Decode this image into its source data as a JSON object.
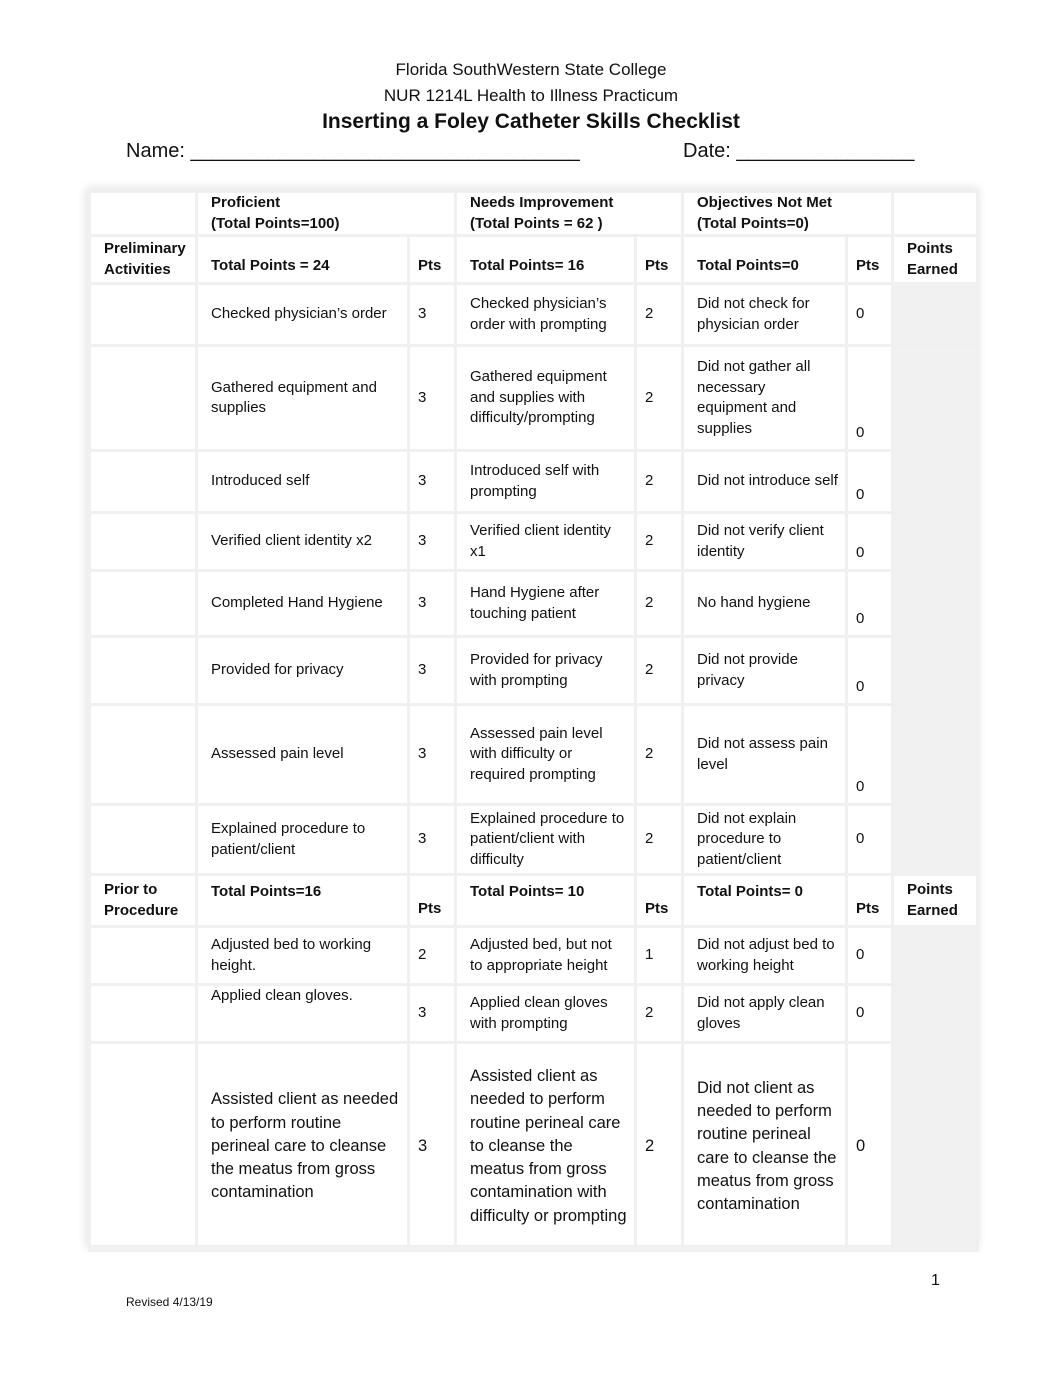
{
  "header": {
    "institution": "Florida SouthWestern State College",
    "course": "NUR 1214L Health to Illness Practicum",
    "title": "Inserting a Foley Catheter Skills Checklist",
    "name_label": "Name: ___________________________________",
    "date_label": "Date: ________________"
  },
  "table": {
    "levels": {
      "proficient": {
        "title": "Proficient",
        "total": "(Total Points=100)"
      },
      "needs_improvement": {
        "title": "Needs Improvement",
        "total": "(Total Points = 62 )"
      },
      "not_met": {
        "title": "Objectives Not Met",
        "total": "(Total Points=0)"
      }
    },
    "sections": [
      {
        "name": "Preliminary Activities",
        "proficient_total": "Total Points = 24",
        "needs_total": "Total Points= 16",
        "notmet_total": "Total Points=0",
        "pts_label": "Pts",
        "earned_label": "Points Earned",
        "rows": [
          {
            "proficient": "Checked physician’s order",
            "p_pts": "3",
            "needs": "Checked physician’s order with prompting",
            "n_pts": "2",
            "notmet": "Did not check for physician order",
            "m_pts": "0"
          },
          {
            "proficient": "Gathered equipment and supplies",
            "p_pts": "3",
            "needs": "Gathered equipment and supplies with difficulty/prompting",
            "n_pts": "2",
            "notmet": "Did not gather all necessary equipment and supplies",
            "m_pts": "0"
          },
          {
            "proficient": "Introduced self",
            "p_pts": "3",
            "needs": "Introduced self with prompting",
            "n_pts": "2",
            "notmet": "Did not introduce self",
            "m_pts": "0"
          },
          {
            "proficient": "Verified client identity x2",
            "p_pts": "3",
            "needs": "Verified client identity x1",
            "n_pts": "2",
            "notmet": "Did not verify client identity",
            "m_pts": "0"
          },
          {
            "proficient": "Completed Hand Hygiene",
            "p_pts": "3",
            "needs": "Hand Hygiene after touching patient",
            "n_pts": "2",
            "notmet": "No hand hygiene",
            "m_pts": "0"
          },
          {
            "proficient": "Provided for privacy",
            "p_pts": "3",
            "needs": "Provided for privacy with prompting",
            "n_pts": "2",
            "notmet": "Did not provide privacy",
            "m_pts": "0"
          },
          {
            "proficient": "Assessed pain level",
            "p_pts": "3",
            "needs": "Assessed pain level with difficulty or required prompting",
            "n_pts": "2",
            "notmet": "Did not assess pain level",
            "m_pts": "0"
          },
          {
            "proficient": "Explained procedure to patient/client",
            "p_pts": "3",
            "needs": "Explained procedure to patient/client with difficulty",
            "n_pts": "2",
            "notmet": "Did not explain procedure to patient/client",
            "m_pts": "0"
          }
        ]
      },
      {
        "name": "Prior to Procedure",
        "proficient_total": "Total Points=16",
        "needs_total": "Total Points= 10",
        "notmet_total": "Total Points= 0",
        "pts_label": "Pts",
        "earned_label": "Points Earned",
        "rows": [
          {
            "proficient": "Adjusted bed to working height.",
            "p_pts": "2",
            "needs": "Adjusted bed, but not to appropriate height",
            "n_pts": "1",
            "notmet": "Did not adjust bed to working height",
            "m_pts": "0"
          },
          {
            "proficient": "Applied clean gloves.",
            "p_pts": "3",
            "needs": "Applied clean gloves with prompting",
            "n_pts": "2",
            "notmet": "Did not apply clean gloves",
            "m_pts": "0"
          },
          {
            "proficient": "Assisted client as needed to perform routine perineal care to cleanse the meatus from gross contamination",
            "p_pts": "3",
            "needs": "Assisted client as needed to perform routine perineal care to cleanse the meatus from gross contamination with difficulty or prompting",
            "n_pts": "2",
            "notmet": "Did not client as needed to perform routine perineal care to cleanse the meatus from gross contamination",
            "m_pts": "0"
          }
        ]
      }
    ]
  },
  "footer": {
    "page_number": "1",
    "revised": "Revised 4/13/19"
  }
}
